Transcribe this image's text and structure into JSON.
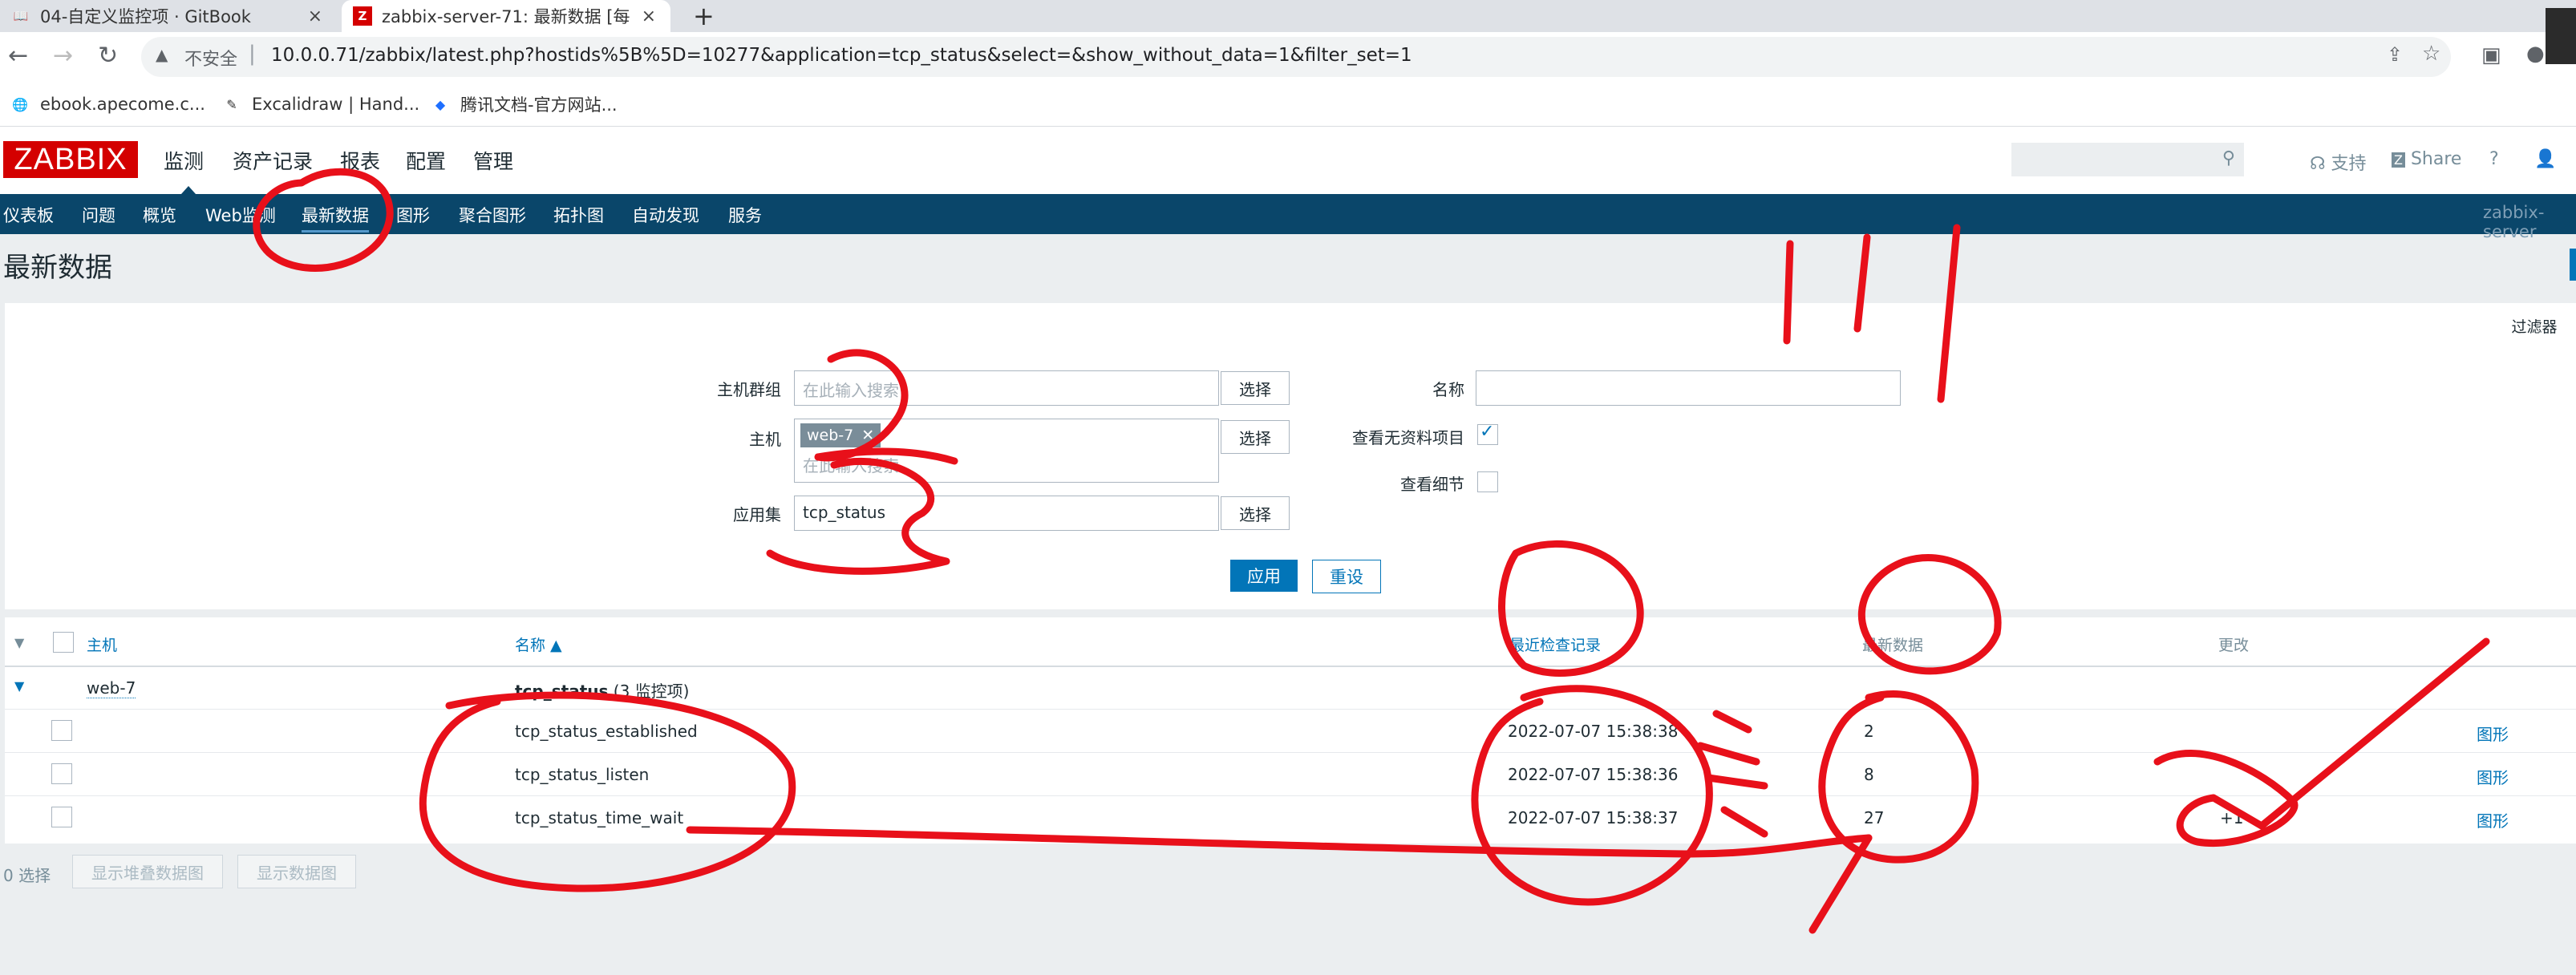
{
  "browser": {
    "tabs": [
      {
        "title": "04-自定义监控项 · GitBook",
        "close": "×"
      },
      {
        "title": "zabbix-server-71: 最新数据 [每",
        "close": "×"
      }
    ],
    "new_tab": "+",
    "security_label": "不安全",
    "url": "10.0.0.71/zabbix/latest.php?hostids%5B%5D=10277&application=tcp_status&select=&show_without_data=1&filter_set=1",
    "bookmarks": [
      "ebook.apecome.c...",
      "Excalidraw | Hand...",
      "腾讯文档-官方网站..."
    ]
  },
  "zabbix": {
    "logo": "ZABBIX",
    "main_menu": [
      "监测",
      "资产记录",
      "报表",
      "配置",
      "管理"
    ],
    "header_links": {
      "support": "支持",
      "share": "Share",
      "help": "?"
    },
    "sub_menu": [
      "仪表板",
      "问题",
      "概览",
      "Web监测",
      "最新数据",
      "图形",
      "聚合图形",
      "拓扑图",
      "自动发现",
      "服务"
    ],
    "server_name": "zabbix-server",
    "page_title": "最新数据",
    "filter_tab": "过滤器",
    "filter": {
      "host_group_label": "主机群组",
      "host_group_placeholder": "在此输入搜索",
      "host_label": "主机",
      "host_chip": "web-7",
      "host_placeholder": "在此输入搜索",
      "app_label": "应用集",
      "app_value": "tcp_status",
      "select_button": "选择",
      "name_label": "名称",
      "show_without_data_label": "查看无资料项目",
      "show_without_data": true,
      "show_details_label": "查看细节",
      "show_details": false,
      "apply_button": "应用",
      "reset_button": "重设"
    },
    "table": {
      "headers": {
        "host": "主机",
        "name": "名称 ▲",
        "last_check": "最近检查记录",
        "last_value": "最新数据",
        "change": "更改"
      },
      "group_host": "web-7",
      "group_app": "tcp_status",
      "group_count": "(3 监控项)",
      "rows": [
        {
          "name": "tcp_status_established",
          "last_check": "2022-07-07 15:38:38",
          "value": "2",
          "change": "",
          "graph": "图形"
        },
        {
          "name": "tcp_status_listen",
          "last_check": "2022-07-07 15:38:36",
          "value": "8",
          "change": "",
          "graph": "图形"
        },
        {
          "name": "tcp_status_time_wait",
          "last_check": "2022-07-07 15:38:37",
          "value": "27",
          "change": "+1",
          "graph": "图形"
        }
      ]
    },
    "footer": {
      "selected": "0 选择",
      "stacked_graph": "显示堆叠数据图",
      "data_graph": "显示数据图"
    }
  },
  "colors": {
    "annotation": "#e8101a",
    "brand": "#d40000",
    "nav": "#0a466a",
    "link": "#0275b8"
  }
}
